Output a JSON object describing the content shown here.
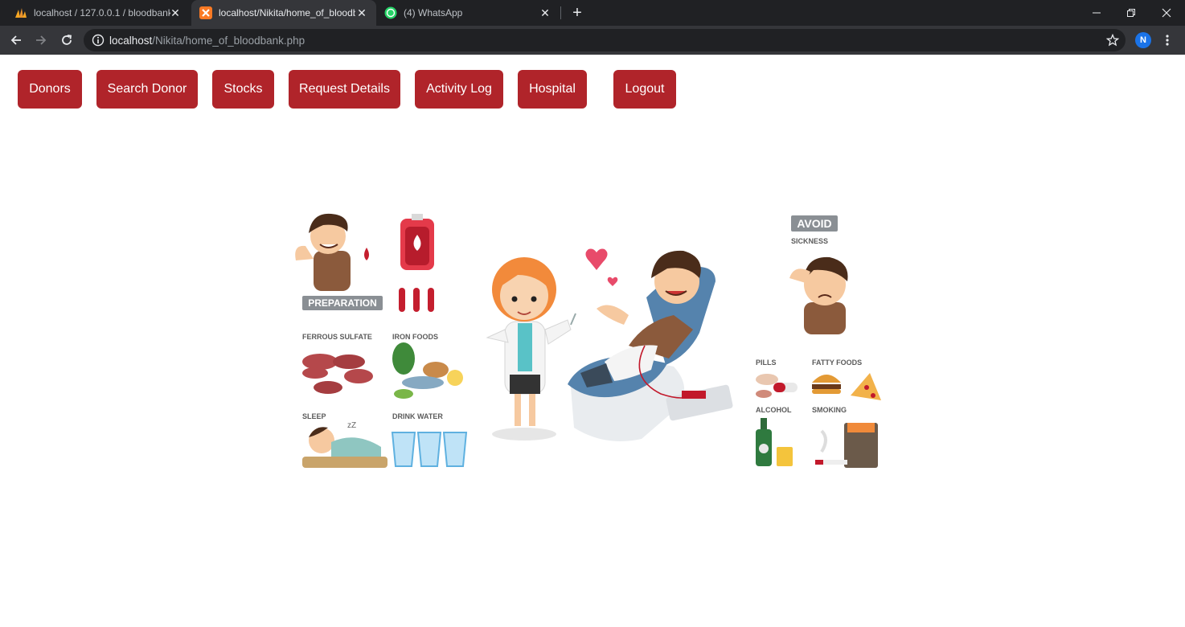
{
  "browser": {
    "tabs": [
      {
        "title": "localhost / 127.0.0.1 / bloodbank",
        "icon": "phpmyadmin-icon"
      },
      {
        "title": "localhost/Nikita/home_of_bloodbank.php",
        "icon": "xampp-icon"
      },
      {
        "title": "(4) WhatsApp",
        "icon": "whatsapp-icon"
      }
    ],
    "url_host": "localhost",
    "url_path": "/Nikita/home_of_bloodbank.php",
    "profile_initial": "N"
  },
  "nav": {
    "donors": "Donors",
    "search_donor": "Search Donor",
    "stocks": "Stocks",
    "request_details": "Request Details",
    "activity_log": "Activity Log",
    "hospital": "Hospital",
    "logout": "Logout"
  },
  "illustration": {
    "preparation": "PREPARATION",
    "ferrous_sulfate": "FERROUS SULFATE",
    "iron_foods": "IRON FOODS",
    "sleep": "SLEEP",
    "drink_water": "DRINK WATER",
    "avoid": "AVOID",
    "sickness": "SICKNESS",
    "pills": "PILLS",
    "fatty_foods": "FATTY FOODS",
    "alcohol": "ALCOHOL",
    "smoking": "SMOKING"
  },
  "colors": {
    "button": "#b0242a",
    "chrome_dark": "#202124",
    "chrome_toolbar": "#35363a"
  }
}
